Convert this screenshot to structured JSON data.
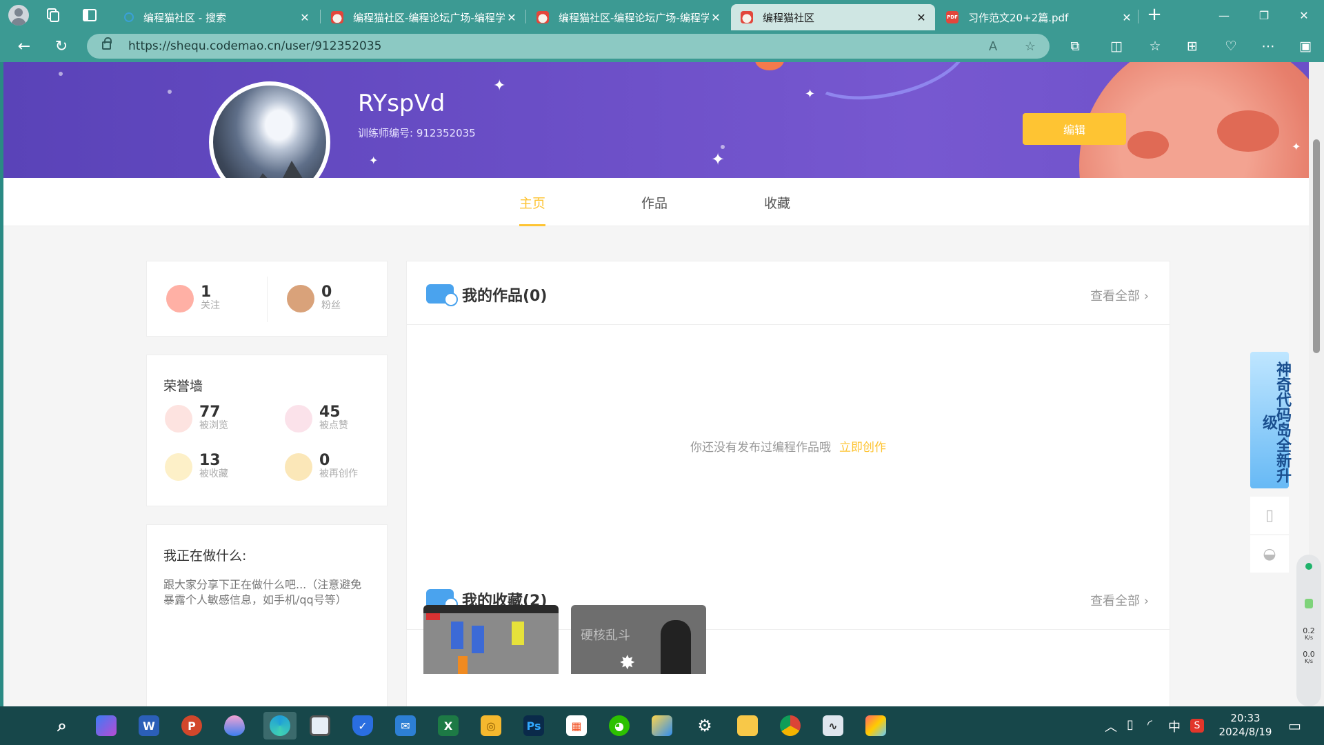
{
  "browser": {
    "tabs": [
      {
        "title": "编程猫社区 - 搜索",
        "favicon": "search-icon",
        "active": false
      },
      {
        "title": "编程猫社区-编程论坛广场-编程学",
        "favicon": "codemao-icon",
        "active": false
      },
      {
        "title": "编程猫社区-编程论坛广场-编程学",
        "favicon": "codemao-icon",
        "active": false
      },
      {
        "title": "编程猫社区",
        "favicon": "codemao-icon",
        "active": true
      },
      {
        "title": "习作范文20+2篇.pdf",
        "favicon": "pdf-icon",
        "active": false
      }
    ],
    "pdf_badge": "PDF",
    "address": "https://shequ.codemao.cn/user/912352035",
    "accent": "#3c9a93"
  },
  "profile": {
    "username": "RYspVd",
    "trainer_id": "训练师编号: 912352035",
    "edit_label": "编辑"
  },
  "nav": {
    "tabs": [
      "主页",
      "作品",
      "收藏"
    ],
    "active": "主页"
  },
  "follow": {
    "following": {
      "count": "1",
      "label": "关注"
    },
    "followers": {
      "count": "0",
      "label": "粉丝"
    }
  },
  "honor": {
    "title": "荣誉墙",
    "stats": [
      {
        "count": "77",
        "label": "被浏览",
        "icon": "eye-icon"
      },
      {
        "count": "45",
        "label": "被点赞",
        "icon": "like-icon"
      },
      {
        "count": "13",
        "label": "被收藏",
        "icon": "collect-icon"
      },
      {
        "count": "0",
        "label": "被再创作",
        "icon": "remix-icon"
      }
    ]
  },
  "doing": {
    "title": "我正在做什么:",
    "placeholder": "跟大家分享下正在做什么吧...（注意避免暴露个人敏感信息，如手机/qq号等）"
  },
  "works": {
    "title": "我的作品(0)",
    "more": "查看全部",
    "empty_text": "你还没有发布过编程作品哦",
    "create_link": "立即创作"
  },
  "collections": {
    "title": "我的收藏(2)",
    "more": "查看全部",
    "thumb2_text": "硬核乱斗"
  },
  "side": {
    "promo": "神奇代码岛全新升级"
  },
  "network": {
    "up": "0.2",
    "down": "0.0",
    "unit": "K/s"
  },
  "taskbar": {
    "time": "20:33",
    "date": "2024/8/19",
    "ime": "中"
  },
  "colors": {
    "brand_yellow": "#fec433",
    "banner_purple": "#6a4ec6"
  }
}
